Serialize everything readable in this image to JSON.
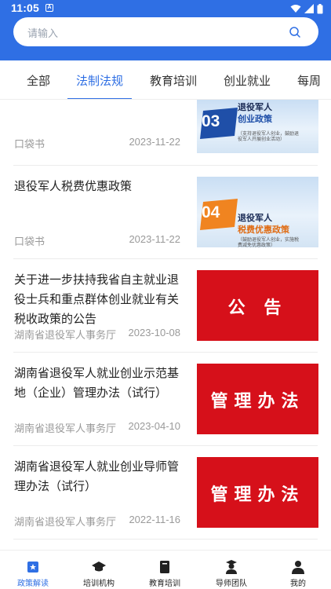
{
  "status_bar": {
    "time": "11:05",
    "notification_icon": "a-box-icon"
  },
  "search": {
    "placeholder": "请输入",
    "icon": "search-icon"
  },
  "tabs": [
    {
      "label": "全部",
      "active": false
    },
    {
      "label": "法制法规",
      "active": true
    },
    {
      "label": "教育培训",
      "active": false
    },
    {
      "label": "创业就业",
      "active": false
    },
    {
      "label": "每周",
      "active": false
    }
  ],
  "articles": [
    {
      "title": "",
      "source": "口袋书",
      "date": "2023-11-22",
      "thumb": {
        "style": "sky",
        "number": "03",
        "line1": "退役军人",
        "line2": "创业政策",
        "line3": "（支持退役军人创业，鼓励退役军人开展创业活动）"
      }
    },
    {
      "title": "退役军人税费优惠政策",
      "source": "口袋书",
      "date": "2023-11-22",
      "thumb": {
        "style": "sky",
        "number": "04",
        "line1": "退役军人",
        "line2": "税费优惠政策",
        "line3": "（鼓励退役军人创业，实施税费减免优惠政策）"
      }
    },
    {
      "title": "关于进一步扶持我省自主就业退役士兵和重点群体创业就业有关税收政策的公告",
      "source": "湖南省退役军人事务厅",
      "date": "2023-10-08",
      "thumb": {
        "style": "red",
        "text": "公  告"
      }
    },
    {
      "title": "湖南省退役军人就业创业示范基地（企业）管理办法（试行）",
      "source": "湖南省退役军人事务厅",
      "date": "2023-04-10",
      "thumb": {
        "style": "red",
        "text": "管理办法"
      }
    },
    {
      "title": "湖南省退役军人就业创业导师管理办法（试行）",
      "source": "湖南省退役军人事务厅",
      "date": "2022-11-16",
      "thumb": {
        "style": "red",
        "text": "管理办法"
      }
    }
  ],
  "bottom_nav": [
    {
      "label": "政策解读",
      "icon": "policy-icon",
      "active": true
    },
    {
      "label": "培训机构",
      "icon": "graduation-cap-icon",
      "active": false
    },
    {
      "label": "教育培训",
      "icon": "book-icon",
      "active": false
    },
    {
      "label": "导师团队",
      "icon": "mentor-icon",
      "active": false
    },
    {
      "label": "我的",
      "icon": "person-icon",
      "active": false
    }
  ],
  "colors": {
    "primary": "#2f6fe4",
    "thumb_red": "#d6101a",
    "badge_blue": "#1f4fa8",
    "badge_orange": "#f08420"
  }
}
